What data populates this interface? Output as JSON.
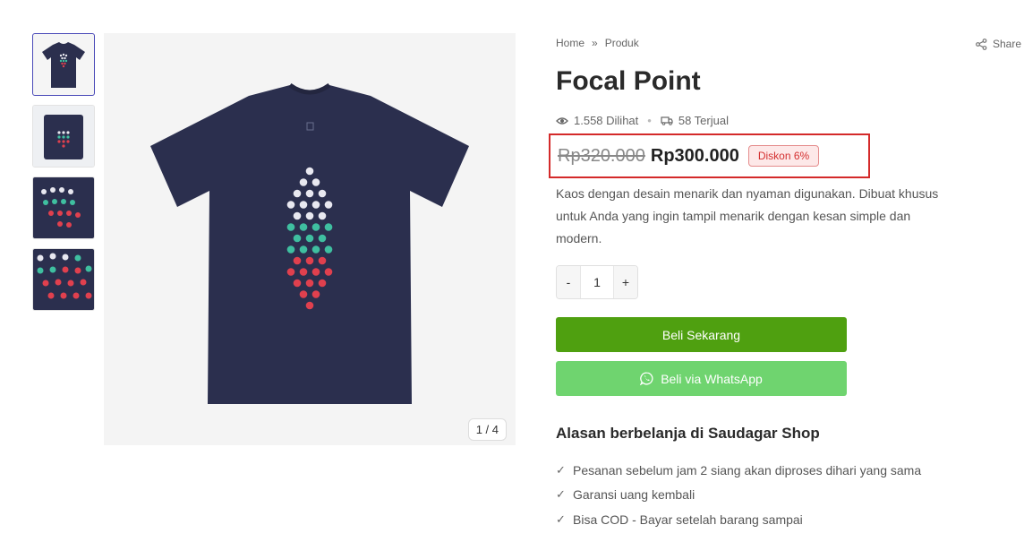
{
  "gallery": {
    "counter": "1 / 4",
    "thumbnails": [
      "shirt-front",
      "shirt-folded",
      "print-detail",
      "print-closeup"
    ]
  },
  "product": {
    "breadcrumb": [
      "Home",
      "»",
      "Produk"
    ],
    "share_label": "Share",
    "title": "Focal Point",
    "views": "1.558 Dilihat",
    "separator": "•",
    "sold": "58 Terjual",
    "old_price": "Rp320.000",
    "new_price": "Rp300.000",
    "discount": "Diskon 6%",
    "description": "Kaos dengan desain menarik dan nyaman digunakan. Dibuat khusus untuk Anda yang ingin tampil menarik dengan kesan simple dan modern.",
    "quantity": {
      "minus": "-",
      "value": "1",
      "plus": "+"
    },
    "buy_label": "Beli Sekarang",
    "whatsapp_label": "Beli via WhatsApp"
  },
  "reasons": {
    "title": "Alasan berbelanja di Saudagar Shop",
    "items": [
      "Pesanan sebelum jam 2 siang akan diproses dihari yang sama",
      "Garansi uang kembali",
      "Bisa COD - Bayar setelah barang sampai"
    ]
  },
  "colors": {
    "shirt": "#2b2f4e",
    "buy": "#4fa010",
    "whatsapp": "#6fd46f",
    "highlight": "#d42a2a"
  }
}
